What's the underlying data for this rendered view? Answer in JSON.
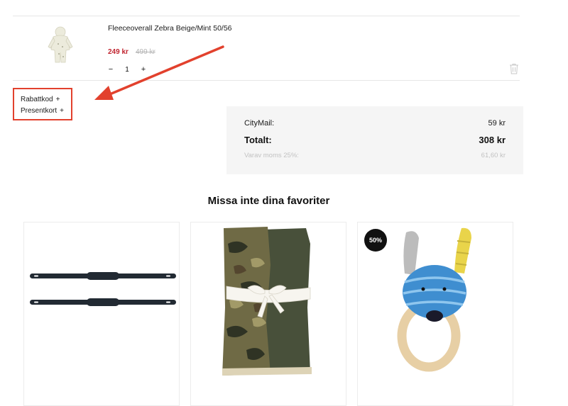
{
  "cart_item": {
    "name": "Fleeceoverall Zebra Beige/Mint 50/56",
    "price_sale": "249 kr",
    "price_original": "499 kr",
    "quantity": "1",
    "qty_minus": "−",
    "qty_plus": "+",
    "image_icon": "fleece-overall-image",
    "remove_icon": "trash-icon"
  },
  "discount": {
    "items": [
      {
        "label": "Rabattkod",
        "toggle": "+"
      },
      {
        "label": "Presentkort",
        "toggle": "+"
      }
    ]
  },
  "summary": {
    "shipping_label": "CityMail:",
    "shipping_value": "59 kr",
    "total_label": "Totalt:",
    "total_value": "308 kr",
    "vat_label": "Varav moms 25%:",
    "vat_value": "61,60 kr"
  },
  "recommendations": {
    "title": "Missa inte dina favoriter",
    "products": [
      {
        "image": "stroller-straps-image",
        "badge": ""
      },
      {
        "image": "muslin-cloths-image",
        "badge": ""
      },
      {
        "image": "dog-teether-rattle-image",
        "badge": "50%"
      }
    ]
  },
  "colors": {
    "sale_price": "#c0242f",
    "annotation": "#e2412d",
    "summary_bg": "#f5f5f5",
    "badge_bg": "#111111"
  }
}
